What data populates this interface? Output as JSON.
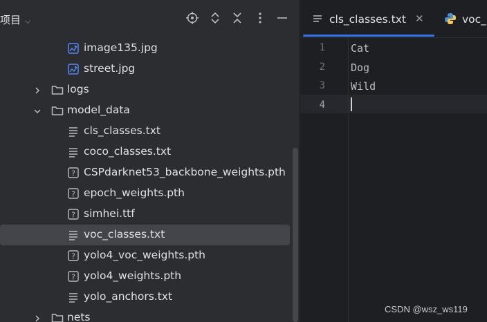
{
  "project_panel": {
    "title": "项目",
    "header_icons": [
      "crosshair-icon",
      "expand-collapse-icon",
      "collapse-all-icon",
      "more-vertical-icon",
      "minimize-icon"
    ],
    "tree": [
      {
        "label": "image135.jpg",
        "icon": "image-file-icon",
        "depth": 3,
        "expanded": null
      },
      {
        "label": "street.jpg",
        "icon": "image-file-icon",
        "depth": 3,
        "expanded": null
      },
      {
        "label": "logs",
        "icon": "folder-icon",
        "depth": 2,
        "expanded": false
      },
      {
        "label": "model_data",
        "icon": "folder-icon",
        "depth": 2,
        "expanded": true
      },
      {
        "label": "cls_classes.txt",
        "icon": "text-file-icon",
        "depth": 3,
        "expanded": null
      },
      {
        "label": "coco_classes.txt",
        "icon": "text-file-icon",
        "depth": 3,
        "expanded": null
      },
      {
        "label": "CSPdarknet53_backbone_weights.pth",
        "icon": "unknown-file-icon",
        "depth": 3,
        "expanded": null
      },
      {
        "label": "epoch_weights.pth",
        "icon": "unknown-file-icon",
        "depth": 3,
        "expanded": null
      },
      {
        "label": "simhei.ttf",
        "icon": "unknown-file-icon",
        "depth": 3,
        "expanded": null
      },
      {
        "label": "voc_classes.txt",
        "icon": "text-file-icon",
        "depth": 3,
        "expanded": null,
        "selected": true
      },
      {
        "label": "yolo4_voc_weights.pth",
        "icon": "unknown-file-icon",
        "depth": 3,
        "expanded": null
      },
      {
        "label": "yolo4_weights.pth",
        "icon": "unknown-file-icon",
        "depth": 3,
        "expanded": null
      },
      {
        "label": "yolo_anchors.txt",
        "icon": "text-file-icon",
        "depth": 3,
        "expanded": null
      },
      {
        "label": "nets",
        "icon": "folder-icon",
        "depth": 2,
        "expanded": false
      }
    ]
  },
  "editor": {
    "tabs": [
      {
        "label": "cls_classes.txt",
        "icon": "text-file-icon",
        "active": true,
        "closable": true
      },
      {
        "label": "voc_",
        "icon": "python-icon",
        "active": false,
        "closable": false
      }
    ],
    "lines": [
      {
        "number": "1",
        "text": "Cat"
      },
      {
        "number": "2",
        "text": "Dog"
      },
      {
        "number": "3",
        "text": "Wild"
      },
      {
        "number": "4",
        "text": ""
      }
    ],
    "current_line": 4
  },
  "watermark": "CSDN @wsz_ws119",
  "colors": {
    "panel_bg": "#2b2d30",
    "editor_bg": "#1e1f22",
    "selection": "#43454a",
    "accent": "#3574f0",
    "image_icon": "#548af7",
    "text": "#dfe1e5"
  }
}
